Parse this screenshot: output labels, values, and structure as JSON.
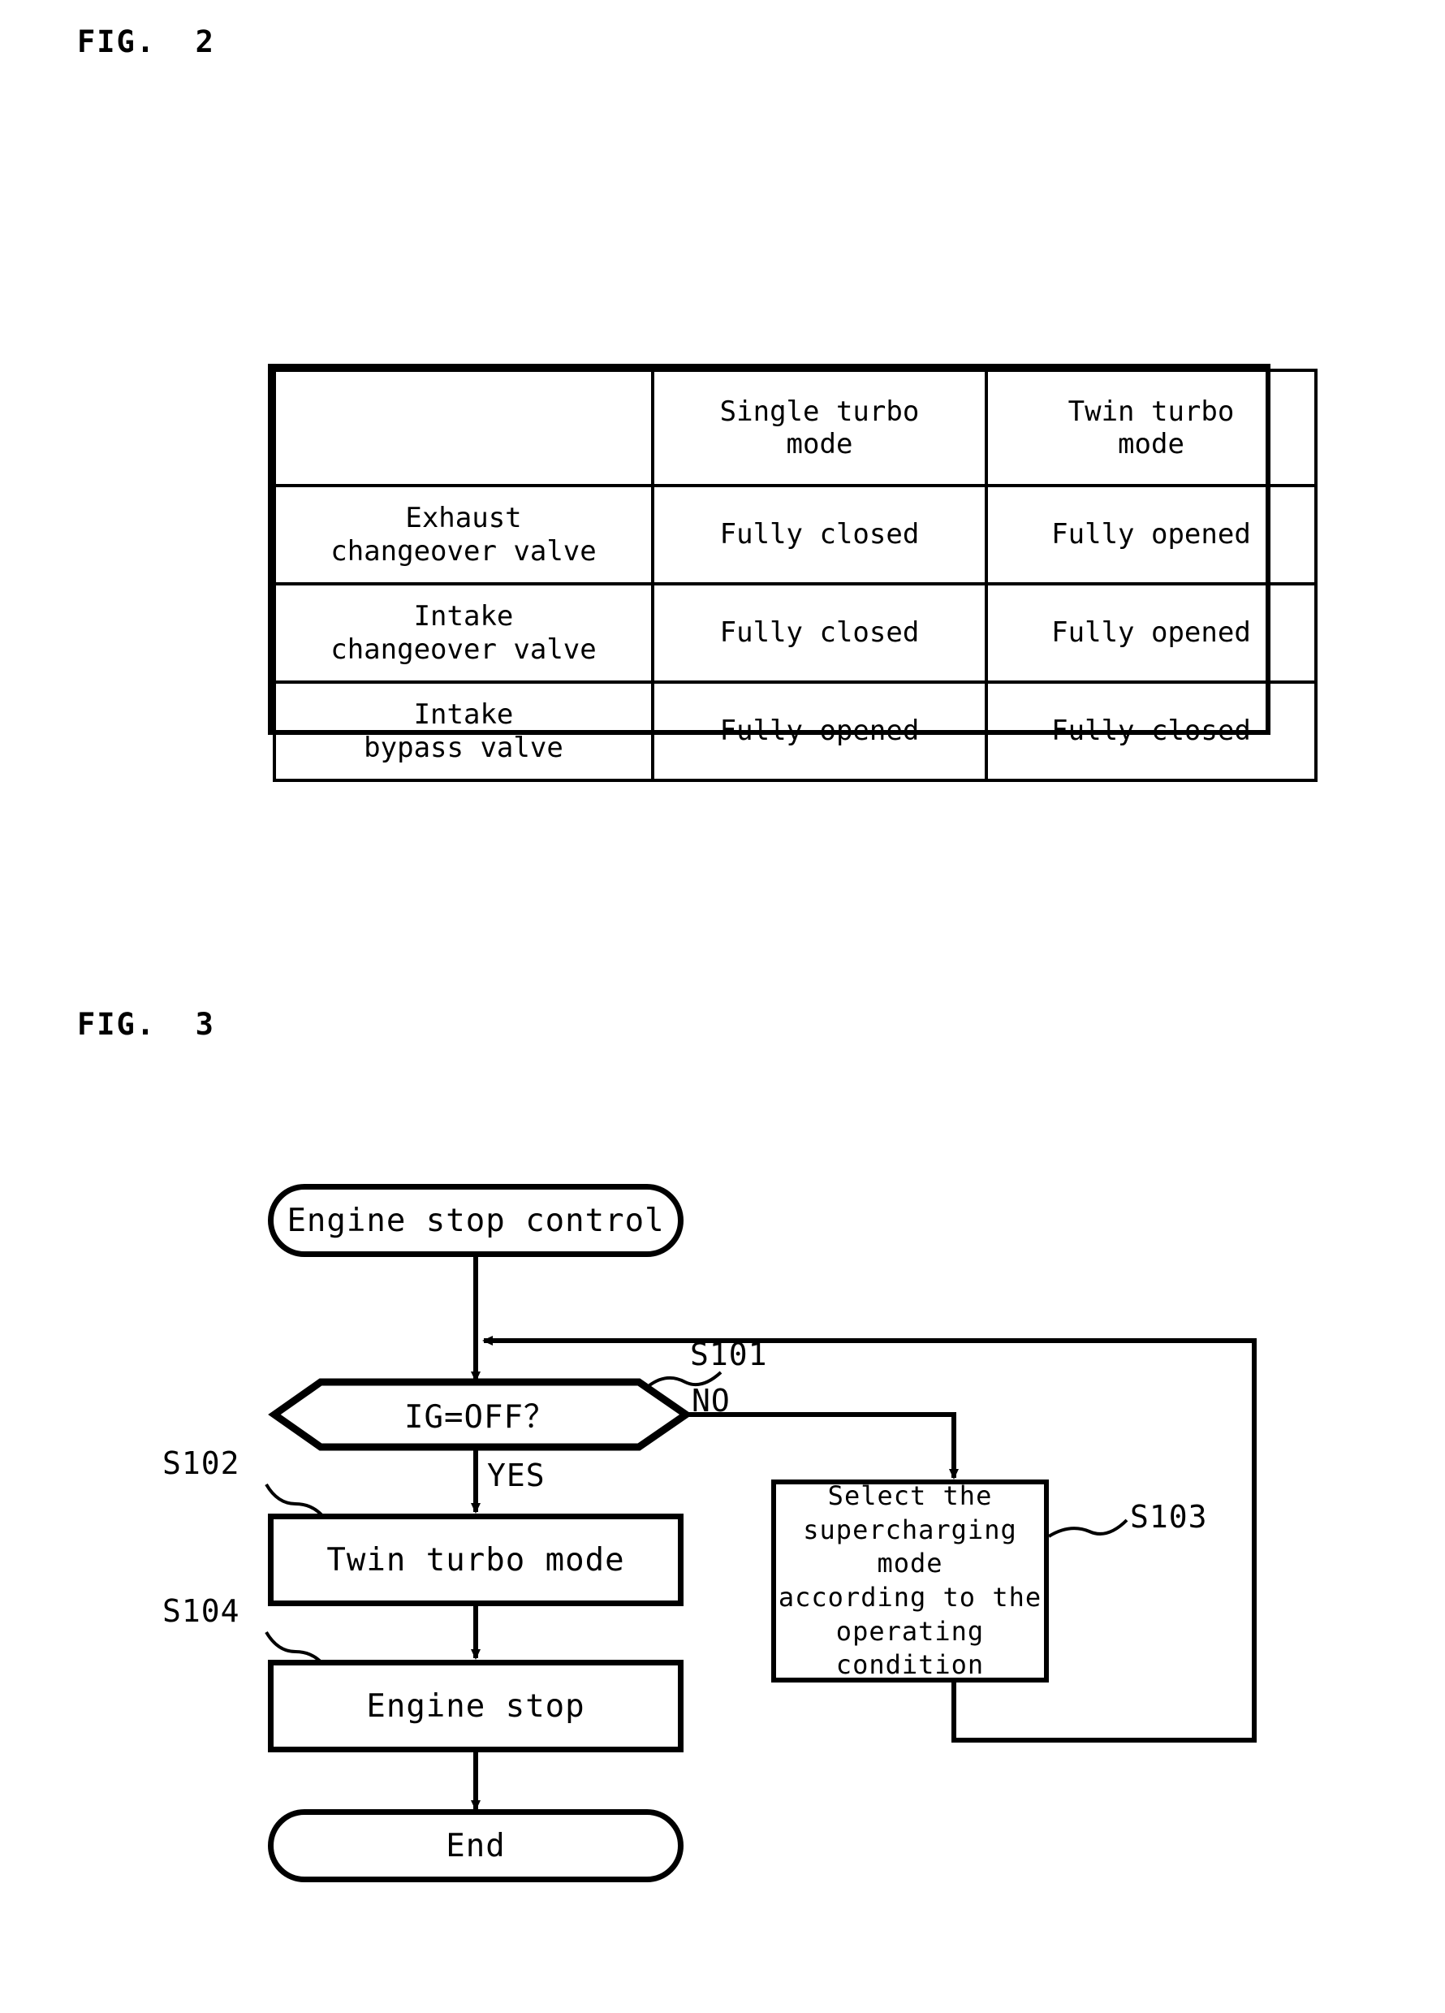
{
  "figures": {
    "fig2_label": "FIG.  2",
    "fig3_label": "FIG.  3"
  },
  "table": {
    "columns": [
      "",
      "Single turbo\nmode",
      "Twin turbo\nmode"
    ],
    "rows": [
      {
        "label": "Exhaust\nchangeover valve",
        "single": "Fully closed",
        "twin": "Fully opened"
      },
      {
        "label": "Intake\nchangeover valve",
        "single": "Fully closed",
        "twin": "Fully opened"
      },
      {
        "label": "Intake\nbypass valve",
        "single": "Fully opened",
        "twin": "Fully closed"
      }
    ]
  },
  "flowchart": {
    "start": "Engine stop control",
    "decision": "IG=OFF？",
    "decision_ref": "S101",
    "branch_no": "NO",
    "branch_yes": "YES",
    "twin_turbo": "Twin turbo mode",
    "twin_turbo_ref": "S102",
    "select_mode": "Select the\nsupercharging mode\naccording to the\noperating condition",
    "select_mode_ref": "S103",
    "engine_stop": "Engine stop",
    "engine_stop_ref": "S104",
    "end": "End"
  }
}
